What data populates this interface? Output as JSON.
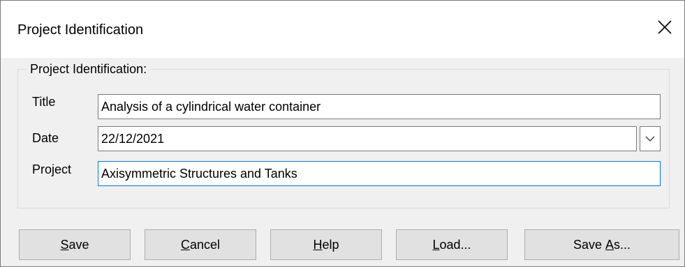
{
  "window": {
    "title": "Project Identification",
    "close_icon": "close-icon"
  },
  "group": {
    "legend": "Project Identification:",
    "fields": {
      "title": {
        "label": "Title",
        "value": "Analysis of a cylindrical water container"
      },
      "date": {
        "label": "Date",
        "value": "22/12/2021"
      },
      "project": {
        "label": "Project",
        "value": "Axisymmetric Structures and Tanks"
      }
    }
  },
  "buttons": {
    "save": {
      "mnemonic": "S",
      "rest": "ave"
    },
    "cancel": {
      "mnemonic": "C",
      "rest": "ancel"
    },
    "help": {
      "mnemonic": "H",
      "rest": "elp"
    },
    "load": {
      "mnemonic": "L",
      "rest": "oad..."
    },
    "save_as": {
      "pre": "Save ",
      "mnemonic": "A",
      "rest": "s..."
    }
  },
  "colors": {
    "focus_border": "#0078d7",
    "dialog_bg": "#f0f0f0"
  }
}
